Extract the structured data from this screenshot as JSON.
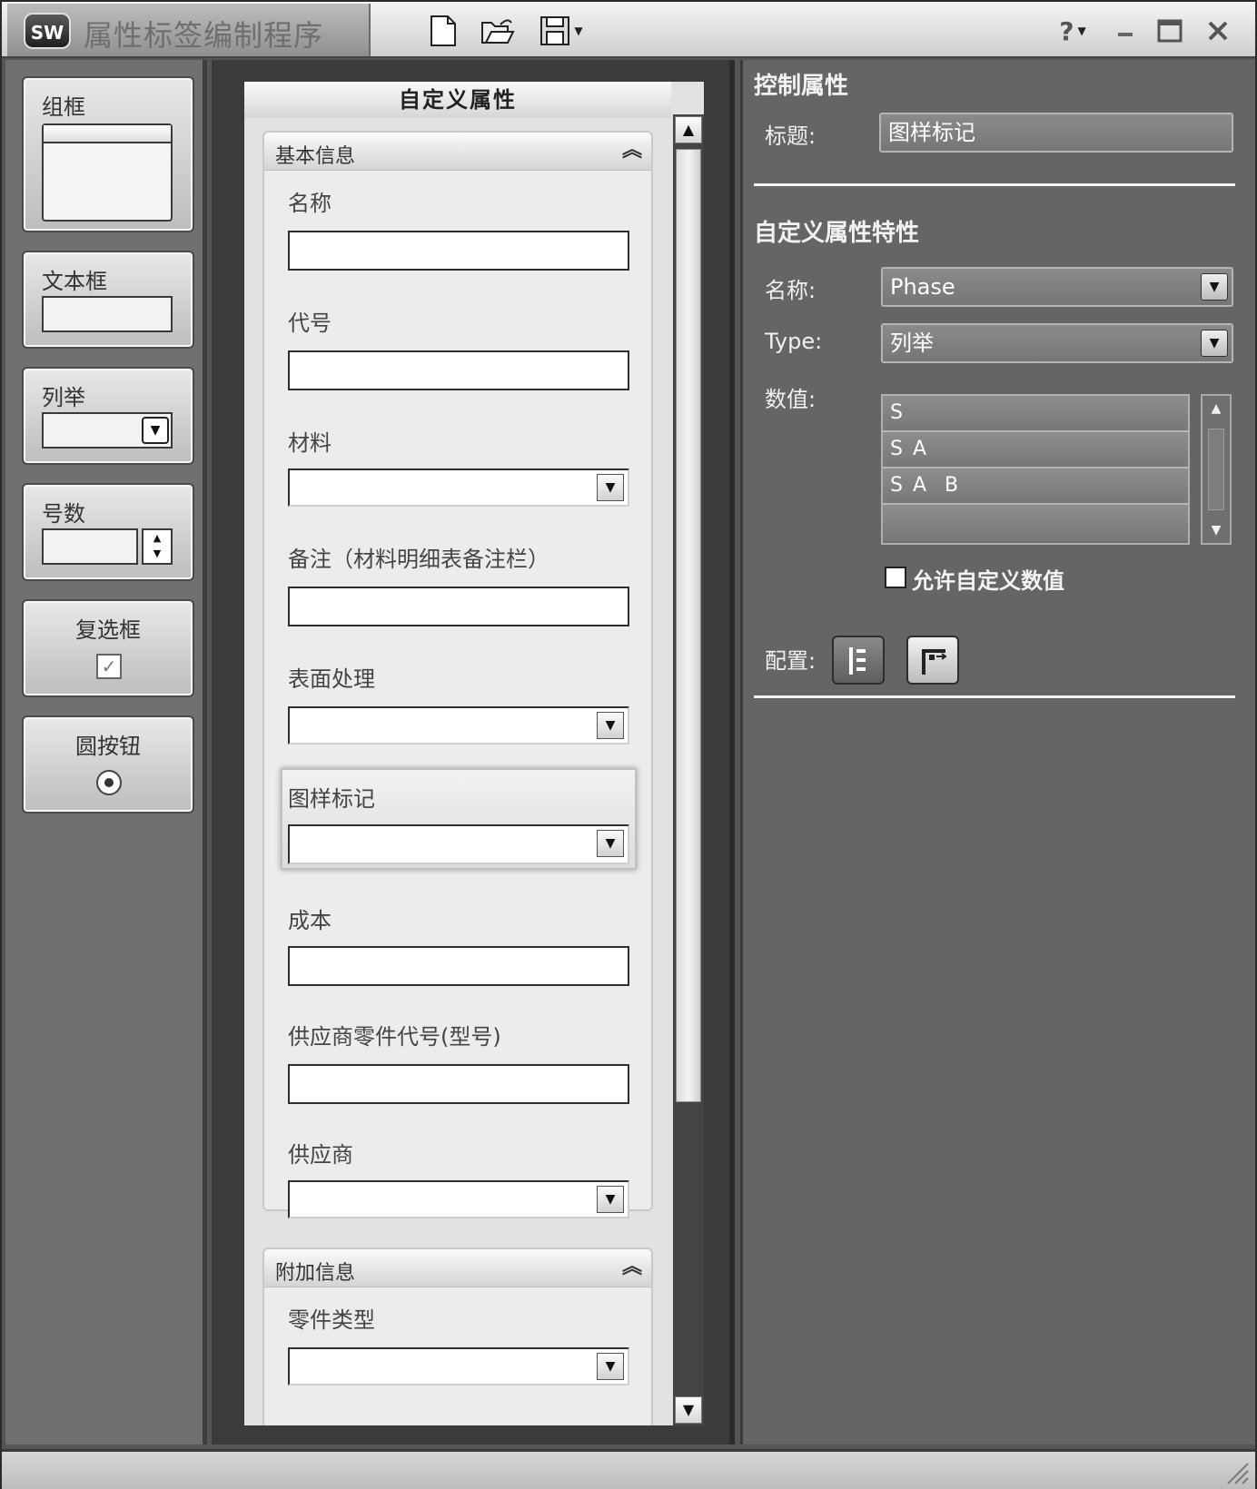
{
  "window": {
    "title": "属性标签编制程序",
    "logo_text": "SW"
  },
  "toolbar": {
    "icons": [
      "new-file-icon",
      "open-folder-icon",
      "save-icon",
      "dropdown-arrow-icon",
      "help-icon",
      "minimize-icon",
      "maximize-icon",
      "close-icon"
    ]
  },
  "toolbox": {
    "items": [
      {
        "label": "组框"
      },
      {
        "label": "文本框"
      },
      {
        "label": "列举"
      },
      {
        "label": "号数"
      },
      {
        "label": "复选框"
      },
      {
        "label": "圆按钮"
      }
    ]
  },
  "form": {
    "title": "自定义属性",
    "groups": [
      {
        "title": "基本信息",
        "fields": [
          {
            "label": "名称",
            "type": "text"
          },
          {
            "label": "代号",
            "type": "text"
          },
          {
            "label": "材料",
            "type": "select"
          },
          {
            "label": "备注（材料明细表备注栏）",
            "type": "text"
          },
          {
            "label": "表面处理",
            "type": "select"
          },
          {
            "label": "图样标记",
            "type": "select"
          },
          {
            "label": "成本",
            "type": "text"
          },
          {
            "label": "供应商零件代号(型号)",
            "type": "text"
          },
          {
            "label": "供应商",
            "type": "select"
          }
        ]
      },
      {
        "title": "附加信息",
        "fields": [
          {
            "label": "零件类型",
            "type": "select"
          }
        ]
      }
    ]
  },
  "properties": {
    "control_heading": "控制属性",
    "caption_label": "标题:",
    "caption_value": "图样标记",
    "custom_heading": "自定义属性特性",
    "name_label": "名称:",
    "name_value": "Phase",
    "type_label": "Type:",
    "type_value": "列举",
    "values_label": "数值:",
    "values": [
      "S",
      "S A",
      "S A  B",
      ""
    ],
    "allow_custom_label": "允许自定义数值",
    "allow_custom_checked": false,
    "config_label": "配置:"
  },
  "colors": {
    "panel_dark": "#555555",
    "right_panel": "#656565",
    "form_bg": "#e2e2e2"
  }
}
